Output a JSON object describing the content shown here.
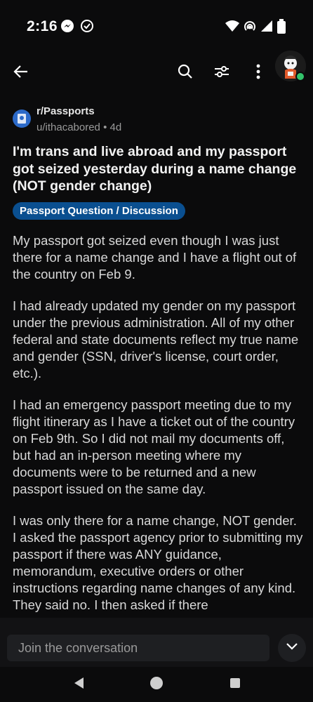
{
  "status_bar": {
    "time": "2:16",
    "icons": [
      "messenger-icon",
      "check-circle-icon",
      "wifi-icon",
      "hotspot-icon",
      "signal-icon",
      "battery-icon"
    ]
  },
  "toolbar": {
    "icons": [
      "back-arrow-icon",
      "search-icon",
      "filter-icon",
      "more-vertical-icon",
      "avatar"
    ]
  },
  "post": {
    "subreddit": "r/Passports",
    "meta": "u/ithacabored • 4d",
    "title": "I'm trans and live abroad and my passport got seized yesterday during a name change (NOT gender change)",
    "flair": "Passport Question / Discussion",
    "paragraphs": [
      "My passport got seized even though I was just there for a name change and I have a flight out of the country on Feb 9.",
      "I had already updated my gender on my passport under the previous administration. All of my other federal and state documents reflect my true name and gender (SSN, driver's license, court order, etc.).",
      "I had an emergency passport meeting due to my flight itinerary as I have a ticket out of the country on Feb 9th. So I did not mail my documents off, but had an in-person meeting where my documents were to be returned and a new passport issued on the same day.",
      "I was only there for a name change, NOT gender. I asked the passport agency prior to submitting my passport if there was ANY guidance, memorandum, executive orders or other instructions regarding name changes of any kind. They said no. I then asked if there"
    ]
  },
  "composer": {
    "placeholder": "Join the conversation"
  },
  "colors": {
    "background": "#0b0b0c",
    "flair_bg": "#0a4f90",
    "online": "#33c36b",
    "subreddit_icon": "#2c6ac9"
  }
}
